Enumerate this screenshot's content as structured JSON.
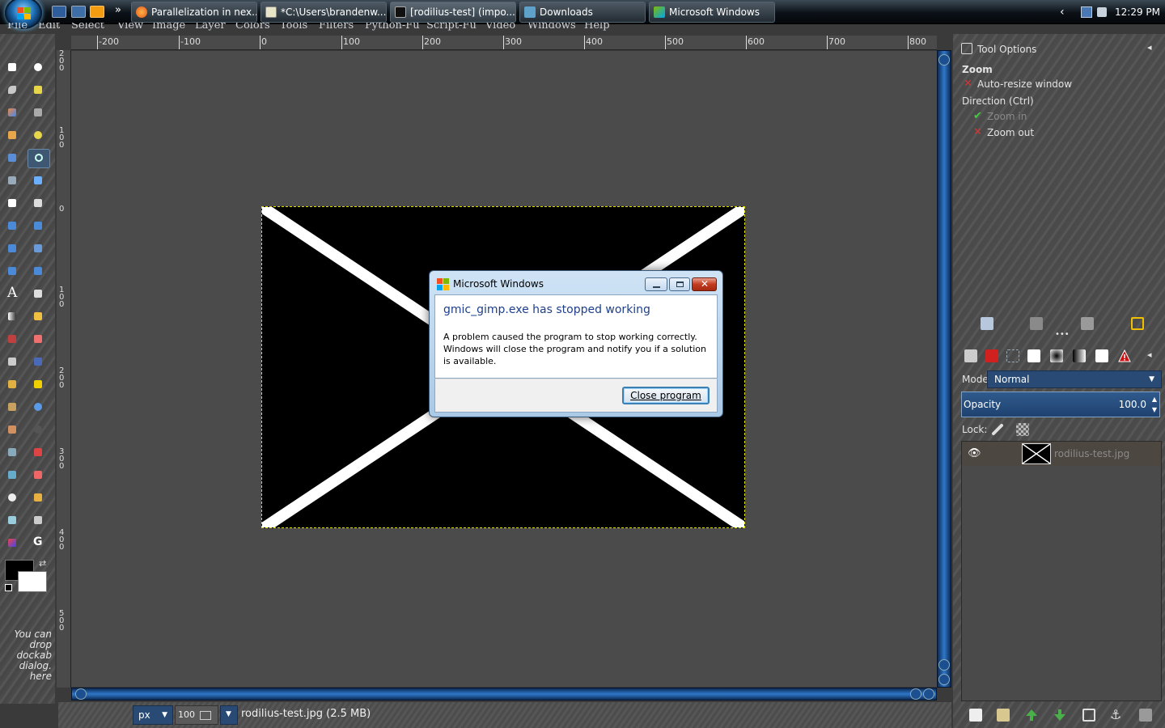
{
  "taskbar": {
    "tasks": [
      {
        "label": "Parallelization in nex..."
      },
      {
        "label": "*C:\\Users\\brandenw..."
      },
      {
        "label": "[rodilius-test] (impo..."
      },
      {
        "label": "Downloads"
      },
      {
        "label": "Microsoft Windows"
      }
    ],
    "overflow": "»",
    "tray_arrow": "‹",
    "clock": "12:29 PM"
  },
  "menubar": {
    "items": [
      "File",
      "Edit",
      "Select",
      "View",
      "Image",
      "Layer",
      "Colors",
      "Tools",
      "Filters",
      "Python-Fu",
      "Script-Fu",
      "Video",
      "Windows",
      "Help"
    ]
  },
  "toolbox": {
    "dock_hint": "You can drop dockab dialog. here"
  },
  "rulers": {
    "horizontal": [
      "-200",
      "-100",
      "0",
      "100",
      "200",
      "300",
      "400",
      "500",
      "600",
      "700",
      "800"
    ],
    "vertical": [
      "200",
      "100",
      "0",
      "100",
      "200",
      "300",
      "400",
      "500"
    ]
  },
  "tool_options": {
    "title": "Tool Options",
    "tool_name": "Zoom",
    "auto_resize": "Auto-resize window",
    "direction_label": "Direction  (Ctrl)",
    "zoom_in": "Zoom in",
    "zoom_out": "Zoom out"
  },
  "layers": {
    "mode_label": "Mode:",
    "mode_value": "Normal",
    "opacity_label": "Opacity",
    "opacity_value": "100.0",
    "lock_label": "Lock:",
    "layer_name": "rodilius-test.jpg"
  },
  "statusbar": {
    "unit": "px",
    "zoom": "100",
    "zoom_unit": "%",
    "file_info": "rodilius-test.jpg (2.5 MB)"
  },
  "dialog": {
    "title": "Microsoft Windows",
    "heading": "gmic_gimp.exe has stopped working",
    "message": "A problem caused the program to stop working correctly. Windows will close the program and notify you if a solution is available.",
    "close_button": "Close program"
  },
  "colors": {
    "scroll_blue": "#2f78c9",
    "dialog_heading": "#1e3f8a",
    "canvas_bg": "#4b4b4b",
    "selection_outline": "#e0e000"
  }
}
